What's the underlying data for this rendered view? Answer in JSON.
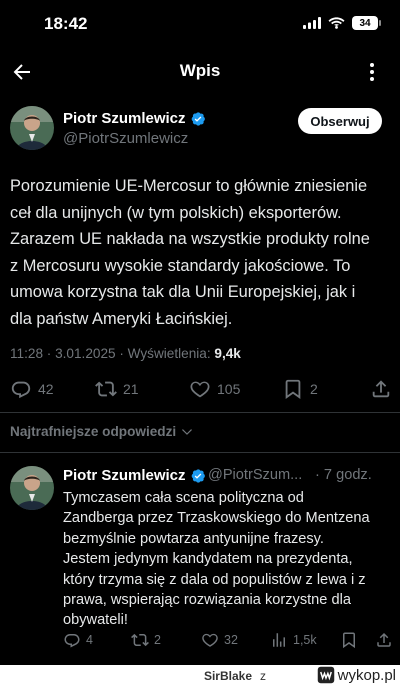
{
  "status_bar": {
    "time": "18:42",
    "battery": "34"
  },
  "nav": {
    "title": "Wpis"
  },
  "tweet": {
    "author_name": "Piotr Szumlewicz",
    "handle": "@PiotrSzumlewicz",
    "follow_label": "Obserwuj",
    "lines": [
      "Porozumienie UE-Mercosur to głównie zniesienie",
      "ceł dla unijnych (w tym polskich) eksporterów.",
      "Zarazem UE nakłada na wszystkie produkty rolne",
      "z Mercosuru wysokie standardy jakościowe. To",
      "umowa korzystna tak dla Unii Europejskiej, jak i",
      "dla państw Ameryki Łacińskiej."
    ],
    "meta": "11:28 · 3.01.2025 · Wyświetlenia: ",
    "views": "9,4k",
    "replies": "42",
    "reposts": "21",
    "likes": "105",
    "bookmarks": "2"
  },
  "sort": {
    "label": "Najtrafniejsze odpowiedzi"
  },
  "reply": {
    "author_name": "Piotr Szumlewicz",
    "handle": "@PiotrSzum...",
    "time": "· 7 godz.",
    "lines": [
      "Tymczasem cała scena polityczna od",
      "Zandberga przez Trzaskowskiego do Mentzena",
      "bezmyślnie powtarza antyunijne frazesy.",
      "Jestem jedynym kandydatem na prezydenta,",
      "który trzyma się z dala od populistów z lewa i z",
      "prawa, wspierając rozwiązania korzystne dla",
      "obywateli!"
    ],
    "replies": "4",
    "reposts": "2",
    "likes": "32",
    "views": "1,5k"
  },
  "watermark": {
    "user": "SirBlake",
    "separator": "z",
    "site": "wykop.pl"
  },
  "colors": {
    "accent": "#1d9bf0",
    "muted": "#71767b",
    "text": "#e7e9ea",
    "background": "#000000"
  },
  "icons": {
    "signal": "cellular-signal-icon",
    "wifi": "wifi-icon",
    "back": "arrow-left-icon",
    "more": "more-dots-icon",
    "verified": "verified-badge-icon",
    "reply": "reply-icon",
    "repost": "repost-icon",
    "like": "heart-icon",
    "bookmark": "bookmark-icon",
    "share": "share-icon",
    "views": "views-chart-icon",
    "chevron": "chevron-down-icon"
  }
}
